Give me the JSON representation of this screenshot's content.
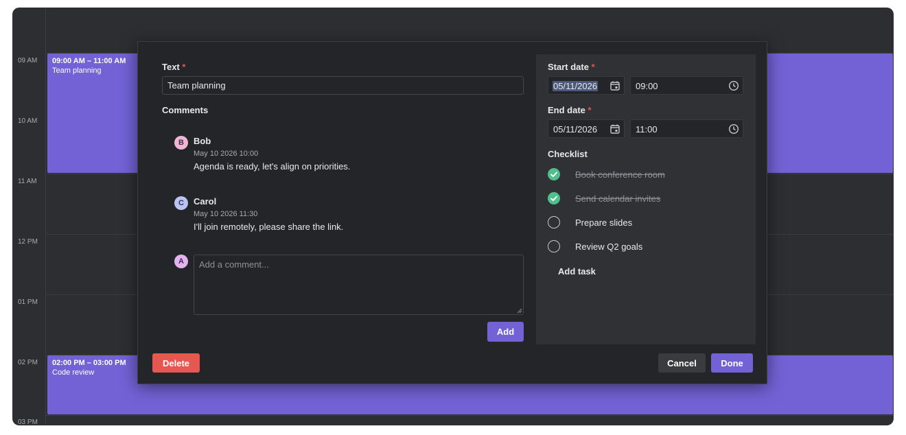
{
  "calendar": {
    "hours": [
      "09 AM",
      "10 AM",
      "11 AM",
      "12 PM",
      "01 PM",
      "02 PM",
      "03 PM"
    ],
    "events": [
      {
        "time": "09:00 AM – 11:00 AM",
        "title": "Team planning"
      },
      {
        "time": "02:00 PM – 03:00 PM",
        "title": "Code review"
      }
    ]
  },
  "editor": {
    "text_label": "Text",
    "required_mark": "*",
    "text_value": "Team planning",
    "comments_label": "Comments",
    "comments": [
      {
        "initial": "B",
        "author": "Bob",
        "date": "May 10 2026 10:00",
        "text": "Agenda is ready, let's align on priorities.",
        "avatar_color": "#f2b5d4"
      },
      {
        "initial": "C",
        "author": "Carol",
        "date": "May 10 2026 11:30",
        "text": "I'll join remotely, please share the link.",
        "avatar_color": "#b9c4f5"
      }
    ],
    "current_user_initial": "A",
    "current_user_color": "#e4b3ef",
    "comment_placeholder": "Add a comment...",
    "add_label": "Add",
    "delete_label": "Delete",
    "cancel_label": "Cancel",
    "done_label": "Done"
  },
  "side": {
    "start_label": "Start date",
    "start_date": "05/11/2026",
    "start_time": "09:00",
    "end_label": "End date",
    "end_date": "05/11/2026",
    "end_time": "11:00",
    "checklist_label": "Checklist",
    "checklist": [
      {
        "text": "Book conference room",
        "done": true
      },
      {
        "text": "Send calendar invites",
        "done": true
      },
      {
        "text": "Prepare slides",
        "done": false
      },
      {
        "text": "Review Q2 goals",
        "done": false
      }
    ],
    "add_task_label": "Add task"
  },
  "colors": {
    "accent": "#7262d6",
    "danger": "#e5574f",
    "success": "#4fbf8b",
    "background": "#2d2e31"
  }
}
